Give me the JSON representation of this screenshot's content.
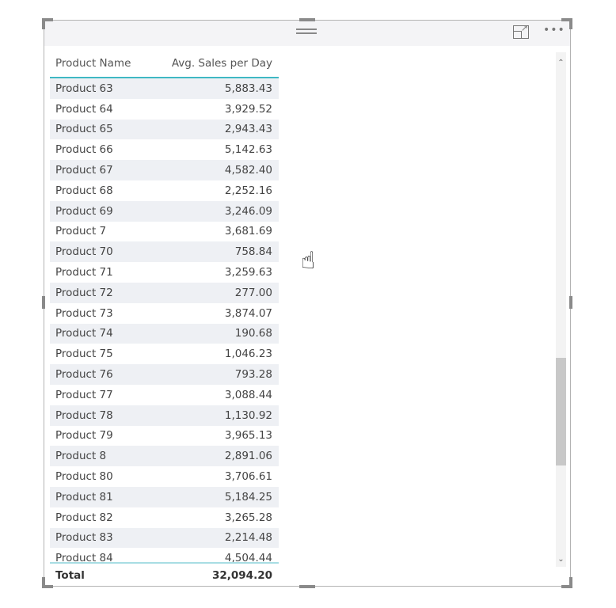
{
  "visual": {
    "header": {
      "product_name": "Product Name",
      "avg_sales": "Avg. Sales per Day"
    },
    "rows": [
      {
        "name": "Product 63",
        "value": "5,883.43"
      },
      {
        "name": "Product 64",
        "value": "3,929.52"
      },
      {
        "name": "Product 65",
        "value": "2,943.43"
      },
      {
        "name": "Product 66",
        "value": "5,142.63"
      },
      {
        "name": "Product 67",
        "value": "4,582.40"
      },
      {
        "name": "Product 68",
        "value": "2,252.16"
      },
      {
        "name": "Product 69",
        "value": "3,246.09"
      },
      {
        "name": "Product 7",
        "value": "3,681.69"
      },
      {
        "name": "Product 70",
        "value": "758.84"
      },
      {
        "name": "Product 71",
        "value": "3,259.63"
      },
      {
        "name": "Product 72",
        "value": "277.00"
      },
      {
        "name": "Product 73",
        "value": "3,874.07"
      },
      {
        "name": "Product 74",
        "value": "190.68"
      },
      {
        "name": "Product 75",
        "value": "1,046.23"
      },
      {
        "name": "Product 76",
        "value": "793.28"
      },
      {
        "name": "Product 77",
        "value": "3,088.44"
      },
      {
        "name": "Product 78",
        "value": "1,130.92"
      },
      {
        "name": "Product 79",
        "value": "3,965.13"
      },
      {
        "name": "Product 8",
        "value": "2,891.06"
      },
      {
        "name": "Product 80",
        "value": "3,706.61"
      },
      {
        "name": "Product 81",
        "value": "5,184.25"
      },
      {
        "name": "Product 82",
        "value": "3,265.28"
      },
      {
        "name": "Product 83",
        "value": "2,214.48"
      },
      {
        "name": "Product 84",
        "value": "4,504.44"
      }
    ],
    "total": {
      "label": "Total",
      "value": "32,094.20"
    },
    "icons": {
      "focus": "focus-mode-icon",
      "more": "more-options-icon",
      "cursor": "hand-pointer-icon"
    },
    "colors": {
      "header_underline": "#3fb8c4",
      "row_stripe": "#eef0f4"
    }
  }
}
